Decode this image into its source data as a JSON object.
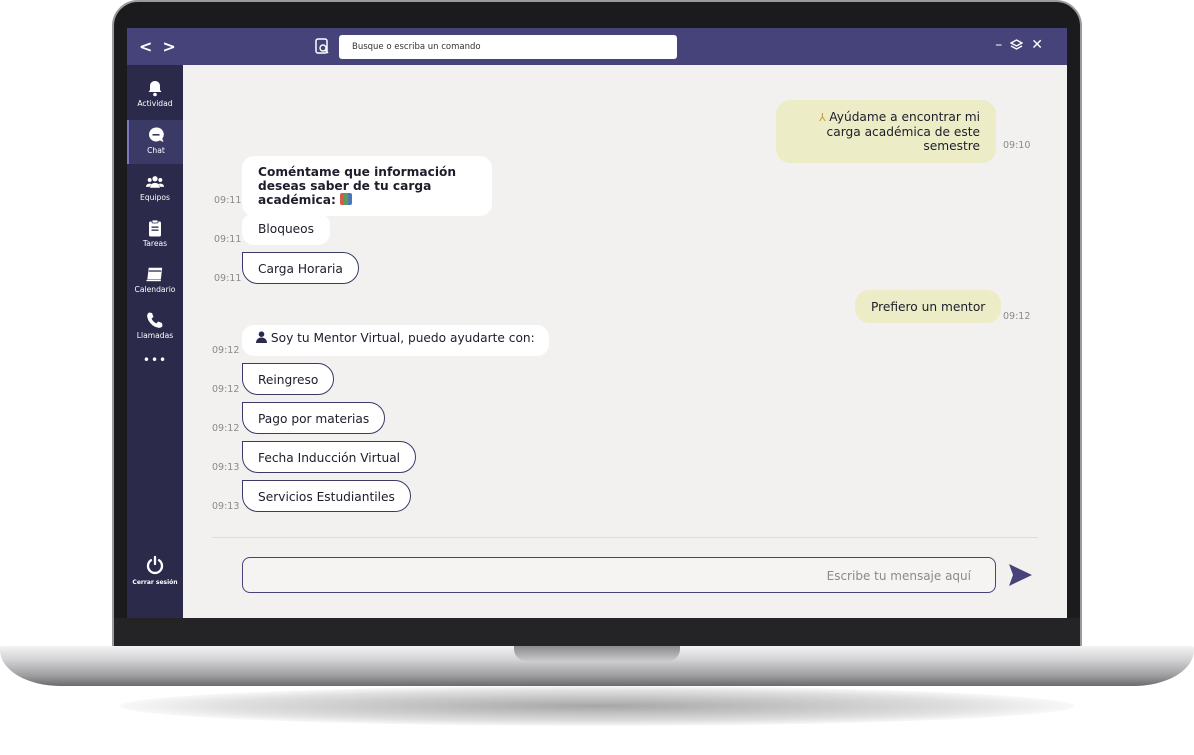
{
  "topbar": {
    "back": "<",
    "forward": ">",
    "search_placeholder": "Busque o escriba un comando",
    "minimize": "–",
    "layers": "⬧",
    "close": "✕"
  },
  "sidebar": {
    "items": [
      {
        "label": "Actividad",
        "icon": "bell-icon"
      },
      {
        "label": "Chat",
        "icon": "chat-icon",
        "active": true
      },
      {
        "label": "Equipos",
        "icon": "team-icon"
      },
      {
        "label": "Tareas",
        "icon": "clipboard-icon"
      },
      {
        "label": "Calendario",
        "icon": "calendar-icon"
      },
      {
        "label": "Llamadas",
        "icon": "phone-icon"
      }
    ],
    "more": "•••",
    "logout": "Cerrar sesión"
  },
  "chat": {
    "messages": [
      {
        "from": "user",
        "text": "Ayúdame a encontrar mi carga académica de este semestre",
        "time": "09:10"
      },
      {
        "from": "bot",
        "text": "Coméntame que información deseas saber de tu carga académica:",
        "time": "09:11"
      },
      {
        "from": "bot",
        "type": "option",
        "text": "Bloqueos",
        "time": "09:11"
      },
      {
        "from": "bot",
        "type": "option",
        "text": "Carga Horaria",
        "time": "09:11"
      },
      {
        "from": "user",
        "text": "Prefiero un mentor",
        "time": "09:12"
      },
      {
        "from": "bot",
        "text": "Soy tu Mentor Virtual, puedo ayudarte con:",
        "time": "09:12"
      },
      {
        "from": "bot",
        "type": "option",
        "text": "Reingreso",
        "time": "09:12"
      },
      {
        "from": "bot",
        "type": "option",
        "text": "Pago por materias",
        "time": "09:12"
      },
      {
        "from": "bot",
        "type": "option",
        "text": "Fecha Inducción Virtual",
        "time": "09:13"
      },
      {
        "from": "bot",
        "type": "option",
        "text": "Servicios Estudiantiles",
        "time": "09:13"
      }
    ],
    "input_placeholder": "Escribe tu mensaje aquí"
  },
  "colors": {
    "accent": "#46437a",
    "sidebar": "#2b2a4b",
    "user_bubble": "#ecedc6",
    "background": "#f2f1ef"
  }
}
